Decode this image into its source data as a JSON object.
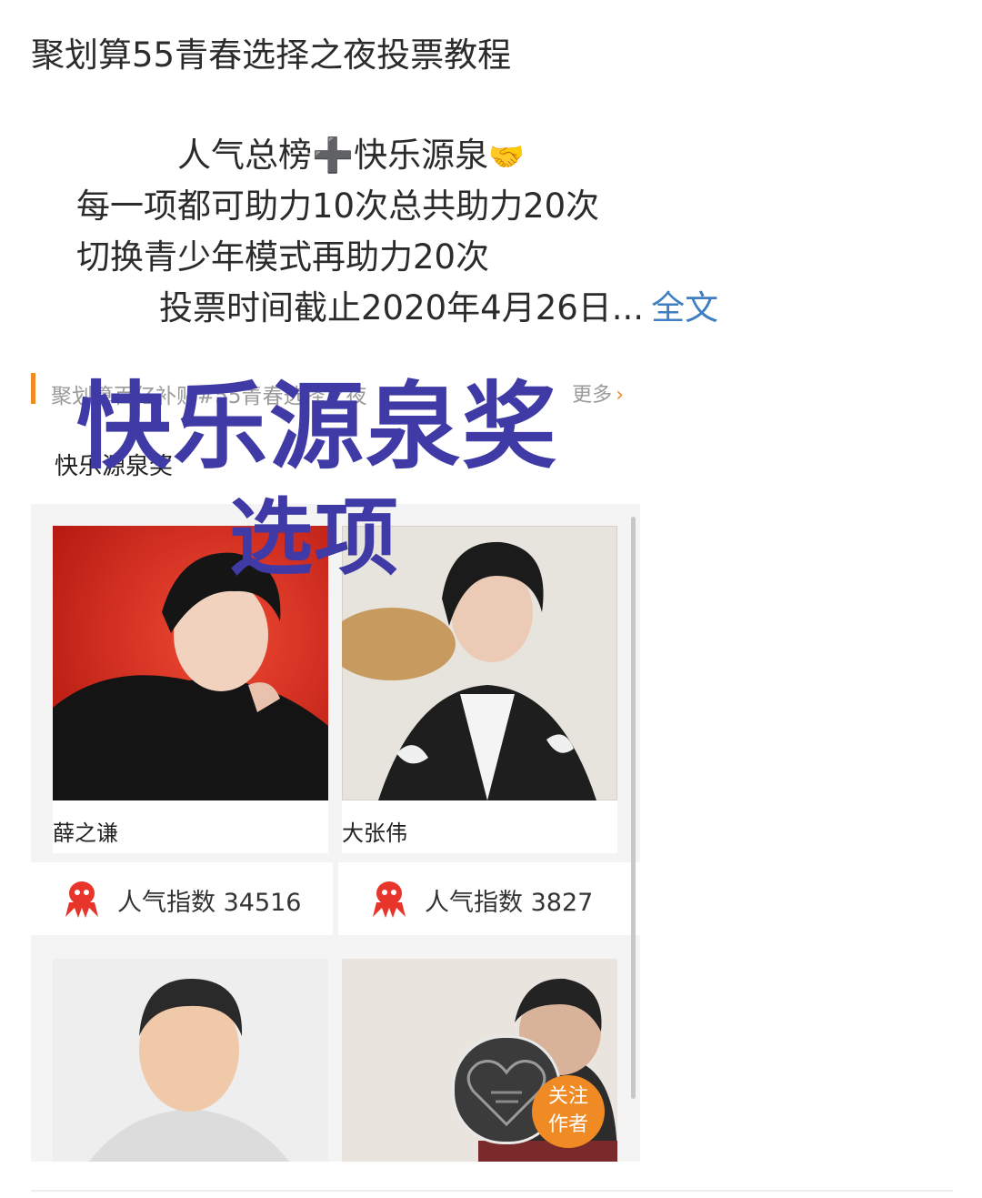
{
  "post": {
    "title": "聚划算55青春选择之夜投票教程",
    "line1_a": "人气总榜",
    "line1_plus": "➕",
    "line1_b": "快乐源泉",
    "line1_hands": "🤝",
    "line2": "每一项都可助力10次总共助力20次",
    "line3": "切换青少年模式再助力20次",
    "line4": "投票时间截止2020年4月26日...",
    "full_text_link": "全文"
  },
  "screenshot": {
    "breadcrumb": "聚划算百亿补贴#55青春选择之夜",
    "more_label": "更多",
    "more_chevron": "›",
    "section_title": "快乐源泉奖",
    "overlay_title": "快乐源泉奖",
    "overlay_subtitle": "选项",
    "candidates": [
      {
        "name": "薛之谦",
        "popularity": "人气指数 34516"
      },
      {
        "name": "大张伟",
        "popularity": "人气指数 3827"
      }
    ]
  },
  "follow_author": {
    "line1": "关注",
    "line2": "作者"
  },
  "colors": {
    "overlay_text": "#3f3aa5",
    "accent": "#f08a24",
    "link": "#3d7fc2",
    "mascot": "#e8352b"
  }
}
